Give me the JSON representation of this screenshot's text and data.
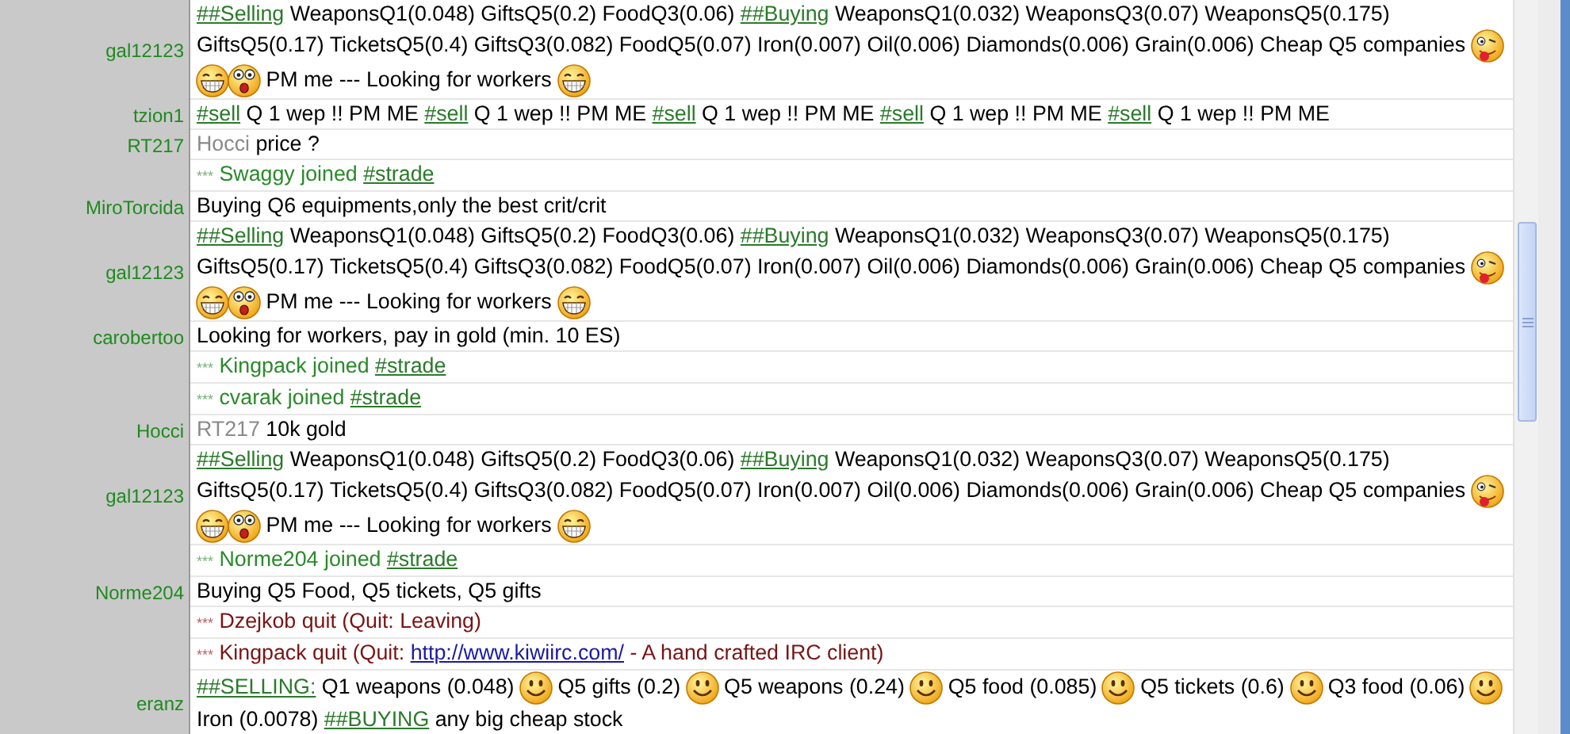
{
  "messages": [
    {
      "kind": "message",
      "nick": "gal12123",
      "segments": [
        {
          "kind": "channel",
          "text": "##Selling"
        },
        {
          "kind": "text",
          "text": " WeaponsQ1(0.048) GiftsQ5(0.2) FoodQ3(0.06) "
        },
        {
          "kind": "channel",
          "text": "##Buying"
        },
        {
          "kind": "text",
          "text": " WeaponsQ1(0.032) WeaponsQ3(0.07) WeaponsQ5(0.175) GiftsQ5(0.17) TicketsQ5(0.4) GiftsQ3(0.082) FoodQ5(0.07) Iron(0.007) Oil(0.006) Diamonds(0.006) Grain(0.006) Cheap Q5 companies "
        },
        {
          "kind": "tongue"
        },
        {
          "kind": "grin"
        },
        {
          "kind": "shocked"
        },
        {
          "kind": "text",
          "text": " PM me --- Looking for workers "
        },
        {
          "kind": "grin"
        }
      ]
    },
    {
      "kind": "message",
      "nick": "tzion1",
      "segments": [
        {
          "kind": "channel",
          "text": "#sell"
        },
        {
          "kind": "text",
          "text": " Q 1 wep !! PM ME "
        },
        {
          "kind": "channel",
          "text": "#sell"
        },
        {
          "kind": "text",
          "text": " Q 1 wep !! PM ME "
        },
        {
          "kind": "channel",
          "text": "#sell"
        },
        {
          "kind": "text",
          "text": " Q 1 wep !! PM ME "
        },
        {
          "kind": "channel",
          "text": "#sell"
        },
        {
          "kind": "text",
          "text": " Q 1 wep !! PM ME "
        },
        {
          "kind": "channel",
          "text": "#sell"
        },
        {
          "kind": "text",
          "text": " Q 1 wep !! PM ME"
        }
      ]
    },
    {
      "kind": "message",
      "nick": "RT217",
      "segments": [
        {
          "kind": "mention",
          "text": "Hocci"
        },
        {
          "kind": "text",
          "text": " price ?"
        }
      ]
    },
    {
      "kind": "join",
      "prefix": "***",
      "segments": [
        {
          "kind": "text",
          "text": " Swaggy joined "
        },
        {
          "kind": "channel",
          "text": "#strade"
        }
      ]
    },
    {
      "kind": "message",
      "nick": "MiroTorcida",
      "segments": [
        {
          "kind": "text",
          "text": "Buying Q6 equipments,only the best crit/crit"
        }
      ]
    },
    {
      "kind": "message",
      "nick": "gal12123",
      "segments": [
        {
          "kind": "channel",
          "text": "##Selling"
        },
        {
          "kind": "text",
          "text": " WeaponsQ1(0.048) GiftsQ5(0.2) FoodQ3(0.06) "
        },
        {
          "kind": "channel",
          "text": "##Buying"
        },
        {
          "kind": "text",
          "text": " WeaponsQ1(0.032) WeaponsQ3(0.07) WeaponsQ5(0.175) GiftsQ5(0.17) TicketsQ5(0.4) GiftsQ3(0.082) FoodQ5(0.07) Iron(0.007) Oil(0.006) Diamonds(0.006) Grain(0.006) Cheap Q5 companies "
        },
        {
          "kind": "tongue"
        },
        {
          "kind": "grin"
        },
        {
          "kind": "shocked"
        },
        {
          "kind": "text",
          "text": " PM me --- Looking for workers "
        },
        {
          "kind": "grin"
        }
      ]
    },
    {
      "kind": "message",
      "nick": "carobertoo",
      "segments": [
        {
          "kind": "text",
          "text": "Looking for workers, pay in gold (min. 10 ES)"
        }
      ]
    },
    {
      "kind": "join",
      "prefix": "***",
      "segments": [
        {
          "kind": "text",
          "text": " Kingpack joined "
        },
        {
          "kind": "channel",
          "text": "#strade"
        }
      ]
    },
    {
      "kind": "join",
      "prefix": "***",
      "segments": [
        {
          "kind": "text",
          "text": " cvarak joined "
        },
        {
          "kind": "channel",
          "text": "#strade"
        }
      ]
    },
    {
      "kind": "message",
      "nick": "Hocci",
      "segments": [
        {
          "kind": "mention",
          "text": "RT217"
        },
        {
          "kind": "text",
          "text": " 10k gold"
        }
      ]
    },
    {
      "kind": "message",
      "nick": "gal12123",
      "segments": [
        {
          "kind": "channel",
          "text": "##Selling"
        },
        {
          "kind": "text",
          "text": " WeaponsQ1(0.048) GiftsQ5(0.2) FoodQ3(0.06) "
        },
        {
          "kind": "channel",
          "text": "##Buying"
        },
        {
          "kind": "text",
          "text": " WeaponsQ1(0.032) WeaponsQ3(0.07) WeaponsQ5(0.175) GiftsQ5(0.17) TicketsQ5(0.4) GiftsQ3(0.082) FoodQ5(0.07) Iron(0.007) Oil(0.006) Diamonds(0.006) Grain(0.006) Cheap Q5 companies "
        },
        {
          "kind": "tongue"
        },
        {
          "kind": "grin"
        },
        {
          "kind": "shocked"
        },
        {
          "kind": "text",
          "text": " PM me --- Looking for workers "
        },
        {
          "kind": "grin"
        }
      ]
    },
    {
      "kind": "join",
      "prefix": "***",
      "segments": [
        {
          "kind": "text",
          "text": " Norme204 joined "
        },
        {
          "kind": "channel",
          "text": "#strade"
        }
      ]
    },
    {
      "kind": "message",
      "nick": "Norme204",
      "segments": [
        {
          "kind": "text",
          "text": "Buying Q5 Food, Q5 tickets, Q5 gifts"
        }
      ]
    },
    {
      "kind": "quit",
      "prefix": "***",
      "segments": [
        {
          "kind": "text",
          "text": " Dzejkob quit (Quit: Leaving)"
        }
      ]
    },
    {
      "kind": "quit",
      "prefix": "***",
      "segments": [
        {
          "kind": "text",
          "text": " Kingpack quit (Quit: "
        },
        {
          "kind": "url",
          "text": "http://www.kiwiirc.com/"
        },
        {
          "kind": "text",
          "text": " - A hand crafted IRC client)"
        }
      ]
    },
    {
      "kind": "message",
      "nick": "eranz",
      "segments": [
        {
          "kind": "channel",
          "text": "##SELLING:"
        },
        {
          "kind": "text",
          "text": " Q1 weapons (0.048) "
        },
        {
          "kind": "smile"
        },
        {
          "kind": "text",
          "text": " Q5 gifts (0.2) "
        },
        {
          "kind": "smile"
        },
        {
          "kind": "text",
          "text": " Q5 weapons (0.24) "
        },
        {
          "kind": "smile"
        },
        {
          "kind": "text",
          "text": " Q5 food (0.085) "
        },
        {
          "kind": "smile"
        },
        {
          "kind": "text",
          "text": " Q5 tickets (0.6) "
        },
        {
          "kind": "smile"
        },
        {
          "kind": "text",
          "text": " Q3 food (0.06) "
        },
        {
          "kind": "smile"
        },
        {
          "kind": "text",
          "text": " Iron (0.0078) "
        },
        {
          "kind": "channel",
          "text": "##BUYING"
        },
        {
          "kind": "text",
          "text": " any big cheap stock"
        }
      ]
    }
  ]
}
